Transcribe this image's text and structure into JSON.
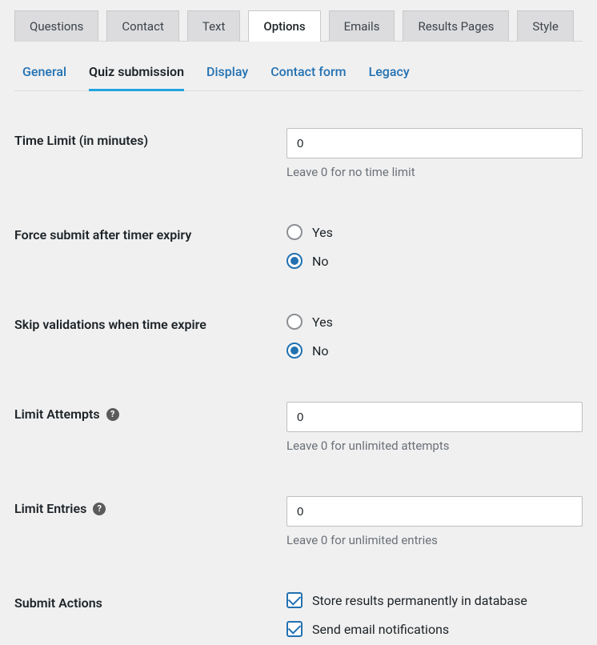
{
  "top_tabs": {
    "questions": "Questions",
    "contact": "Contact",
    "text": "Text",
    "options": "Options",
    "emails": "Emails",
    "results_pages": "Results Pages",
    "style": "Style"
  },
  "sub_tabs": {
    "general": "General",
    "quiz_submission": "Quiz submission",
    "display": "Display",
    "contact_form": "Contact form",
    "legacy": "Legacy"
  },
  "fields": {
    "time_limit": {
      "label": "Time Limit (in minutes)",
      "value": "0",
      "help": "Leave 0 for no time limit"
    },
    "force_submit": {
      "label": "Force submit after timer expiry",
      "option_yes": "Yes",
      "option_no": "No",
      "selected": "no"
    },
    "skip_validations": {
      "label": "Skip validations when time expire",
      "option_yes": "Yes",
      "option_no": "No",
      "selected": "no"
    },
    "limit_attempts": {
      "label": "Limit Attempts",
      "value": "0",
      "help": "Leave 0 for unlimited attempts"
    },
    "limit_entries": {
      "label": "Limit Entries",
      "value": "0",
      "help": "Leave 0 for unlimited entries"
    },
    "submit_actions": {
      "label": "Submit Actions",
      "store_results": {
        "label": "Store results permanently in database",
        "checked": true
      },
      "send_email": {
        "label": "Send email notifications",
        "checked": true
      }
    }
  },
  "help_glyph": "?"
}
